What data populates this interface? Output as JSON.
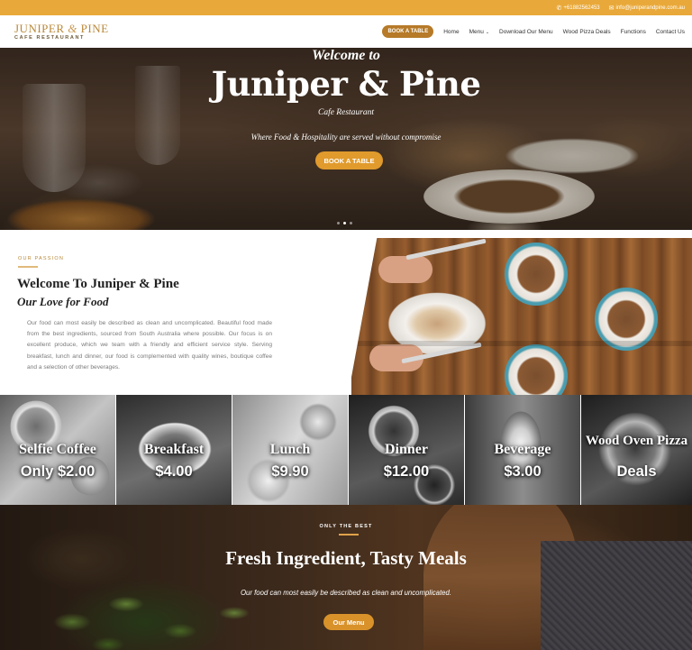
{
  "topbar": {
    "phone": "+61882562453",
    "email": "info@juniperandpine.com.au",
    "phone_icon": "phone-icon",
    "email_icon": "envelope-icon"
  },
  "header": {
    "logo": {
      "name_part1": "JUNIPER",
      "amp": "&",
      "name_part2": "PINE",
      "tagline": "CAFE RESTAURANT"
    },
    "nav": {
      "book": "BOOK A TABLE",
      "home": "Home",
      "menu": "Menu",
      "download": "Download Our Menu",
      "pizza": "Wood Pizza Deals",
      "functions": "Functions",
      "contact": "Contact Us"
    }
  },
  "hero": {
    "welcome": "Welcome to",
    "title": "Juniper & Pine",
    "subtitle": "Cafe Restaurant",
    "tagline": "Where Food & Hospitality are served without compromise",
    "button": "BOOK A TABLE"
  },
  "passion": {
    "eyebrow": "OUR PASSION",
    "title": "Welcome To Juniper & Pine",
    "subtitle": "Our Love for Food",
    "body": "Our food can most easily be described as clean and uncomplicated. Beautiful food made from the best ingredients, sourced from South Australia where possible. Our focus is on excellent produce, which we team with a friendly and efficient service style. Serving breakfast, lunch and dinner, our food is complemented with quality wines, boutique coffee and a selection of other beverages."
  },
  "tiles": [
    {
      "name": "Selfie Coffee",
      "price": "Only $2.00"
    },
    {
      "name": "Breakfast",
      "price": "$4.00"
    },
    {
      "name": "Lunch",
      "price": "$9.90"
    },
    {
      "name": "Dinner",
      "price": "$12.00"
    },
    {
      "name": "Beverage",
      "price": "$3.00"
    },
    {
      "name": "Wood Oven Pizza",
      "price": "Deals"
    }
  ],
  "bottom": {
    "eyebrow": "ONLY THE BEST",
    "title": "Fresh Ingredient, Tasty Meals",
    "description": "Our food can most easily be described as clean and uncomplicated.",
    "button": "Our Menu"
  },
  "colors": {
    "accent": "#e9a93a",
    "button": "#b67a28"
  }
}
